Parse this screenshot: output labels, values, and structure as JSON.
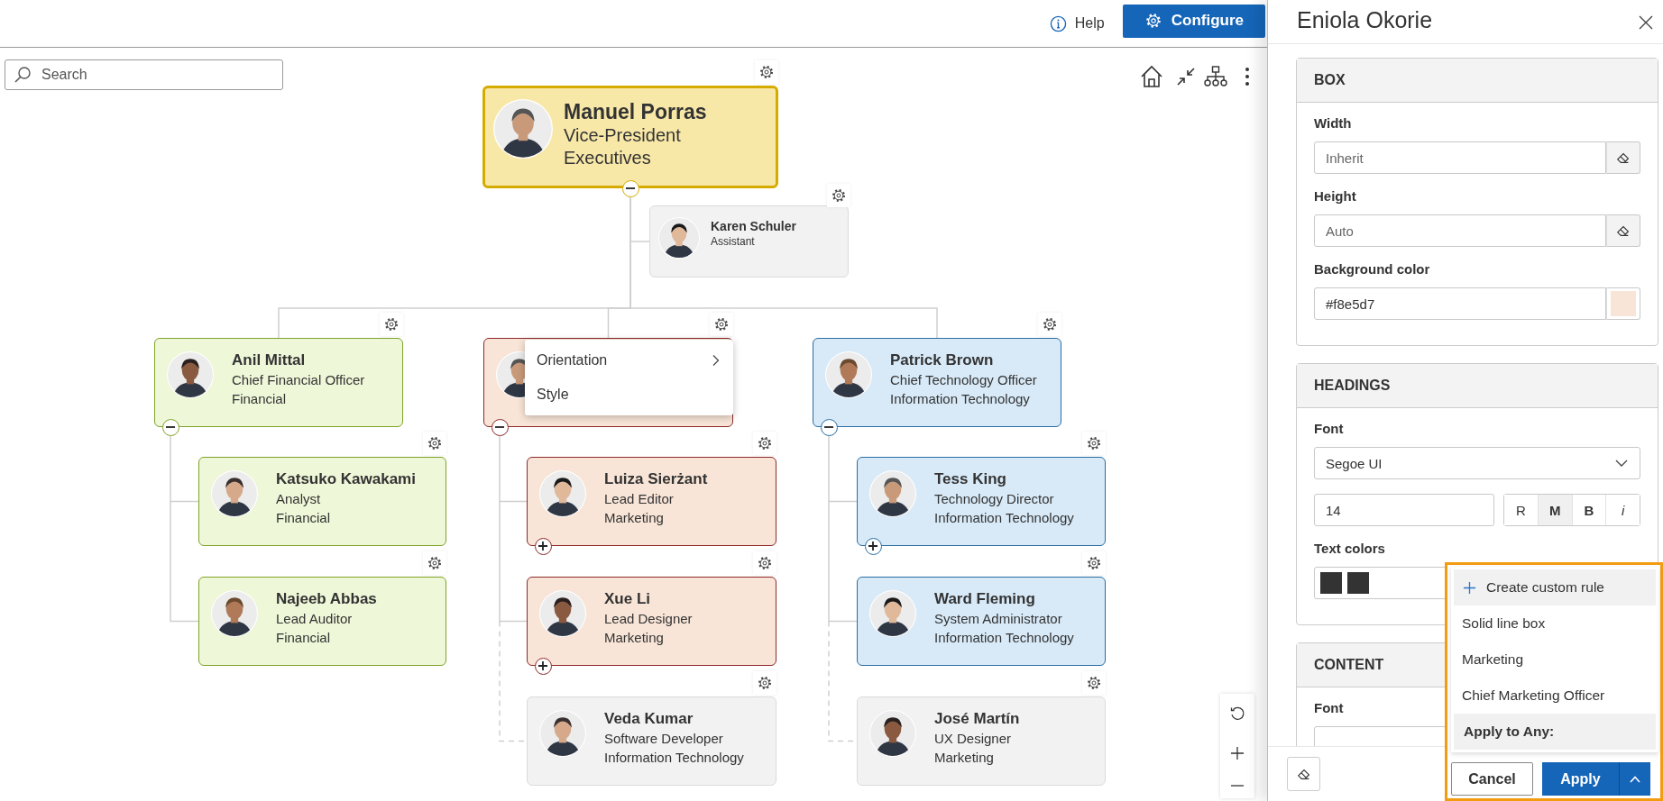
{
  "topbar": {
    "help": "Help",
    "configure": "Configure"
  },
  "search": {
    "placeholder": "Search"
  },
  "chart": {
    "root": {
      "kind": "root",
      "name": "Manuel Porras",
      "title": "Vice-President",
      "department": "Executives",
      "color": "#f8e8a8",
      "expanded": true,
      "assistants": [
        {
          "kind": "assistant",
          "name": "Karen Schuler",
          "title": "Assistant",
          "color": "#f2f2f2",
          "dashed": false
        }
      ],
      "children": [
        {
          "kind": "member",
          "name": "Anil Mittal",
          "title": "Chief Financial Officer",
          "department": "Financial",
          "color": "#eef7d8",
          "expanded": true,
          "dashed": false,
          "children": [
            {
              "kind": "member",
              "name": "Katsuko Kawakami",
              "title": "Analyst",
              "department": "Financial",
              "color": "#eef7d8",
              "dashed": false
            },
            {
              "kind": "member",
              "name": "Najeeb Abbas",
              "title": "Lead Auditor",
              "department": "Financial",
              "color": "#eef7d8",
              "dashed": false
            }
          ]
        },
        {
          "kind": "member",
          "color": "#f8e5d7",
          "expanded": true,
          "dashed": false,
          "children": [
            {
              "kind": "member",
              "name": "Luiza Sierżant",
              "title": "Lead Editor",
              "department": "Marketing",
              "color": "#f8e5d7",
              "expanded": false,
              "dashed": false
            },
            {
              "kind": "member",
              "name": "Xue Li",
              "title": "Lead Designer",
              "department": "Marketing",
              "color": "#f8e5d7",
              "expanded": false,
              "dashed": false
            },
            {
              "kind": "member",
              "name": "Veda Kumar",
              "title": "Software Developer",
              "department": "Information Technology",
              "color": "#f2f2f2",
              "dashed": true
            }
          ]
        },
        {
          "kind": "member",
          "name": "Patrick Brown",
          "title": "Chief Technology Officer",
          "department": "Information Technology",
          "color": "#d8eaf8",
          "expanded": true,
          "dashed": false,
          "children": [
            {
              "kind": "member",
              "name": "Tess King",
              "title": "Technology Director",
              "department": "Information Technology",
              "color": "#d8eaf8",
              "expanded": false,
              "dashed": false
            },
            {
              "kind": "member",
              "name": "Ward Fleming",
              "title": "System Administrator",
              "department": "Information Technology",
              "color": "#d8eaf8",
              "dashed": false
            },
            {
              "kind": "member",
              "name": "José Martín",
              "title": "UX Designer",
              "department": "Marketing",
              "color": "#f2f2f2",
              "dashed": true
            }
          ]
        }
      ]
    }
  },
  "context_menu": {
    "items": [
      {
        "label": "Orientation",
        "submenu": true
      },
      {
        "label": "Style",
        "submenu": false
      }
    ]
  },
  "panel": {
    "title": "Eniola Okorie",
    "sections": [
      {
        "title": "BOX",
        "fields": [
          {
            "kind": "text",
            "label": "Width",
            "placeholder": "Inherit"
          },
          {
            "kind": "text",
            "label": "Height",
            "placeholder": "Auto"
          },
          {
            "kind": "color",
            "label": "Background color",
            "value": "#f8e5d7",
            "color": "#f8e5d7"
          }
        ]
      },
      {
        "title": "HEADINGS",
        "fields": [
          {
            "kind": "select",
            "label": "Font",
            "value": "Segoe UI"
          },
          {
            "kind": "size_weight",
            "value": "14",
            "weights": [
              {
                "label": "R",
                "selected": false
              },
              {
                "label": "M",
                "selected": true
              },
              {
                "label": "B",
                "selected": false
              },
              {
                "label": "i",
                "selected": false
              }
            ]
          },
          {
            "kind": "swatches",
            "label": "Text colors",
            "swatches": [
              {
                "color": "#333333"
              },
              {
                "color": "#333333"
              }
            ]
          }
        ]
      },
      {
        "title": "CONTENT",
        "fields": [
          {
            "kind": "select",
            "label": "Font"
          }
        ]
      }
    ]
  },
  "rule_menu": {
    "items": [
      {
        "kind": "action",
        "label": "Create custom rule"
      },
      {
        "kind": "option",
        "label": "Solid line box"
      },
      {
        "kind": "option",
        "label": "Marketing"
      },
      {
        "kind": "option",
        "label": "Chief Marketing Officer"
      },
      {
        "kind": "header",
        "label": "Apply to Any:"
      }
    ]
  },
  "footer": {
    "cancel": "Cancel",
    "apply": "Apply"
  }
}
